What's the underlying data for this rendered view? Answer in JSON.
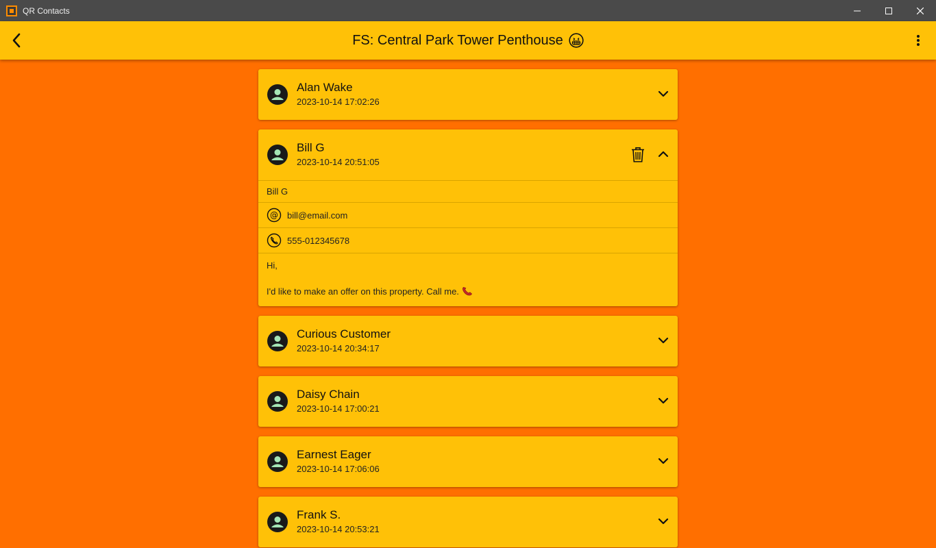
{
  "window": {
    "title": "QR Contacts"
  },
  "appbar": {
    "title": "FS: Central Park Tower Penthouse"
  },
  "contacts": [
    {
      "name": "Alan Wake",
      "date": "2023-10-14 17:02:26",
      "expanded": false
    },
    {
      "name": "Bill G",
      "date": "2023-10-14 20:51:05",
      "expanded": true,
      "details": {
        "full_name": "Bill G",
        "email": "bill@email.com",
        "phone": "555-012345678",
        "message_line1": "Hi,",
        "message_line2": "I'd like to make an offer on this property. Call me."
      }
    },
    {
      "name": "Curious Customer",
      "date": "2023-10-14 20:34:17",
      "expanded": false
    },
    {
      "name": "Daisy Chain",
      "date": "2023-10-14 17:00:21",
      "expanded": false
    },
    {
      "name": "Earnest Eager",
      "date": "2023-10-14 17:06:06",
      "expanded": false
    },
    {
      "name": "Frank S.",
      "date": "2023-10-14 20:53:21",
      "expanded": false
    }
  ],
  "icons": {
    "back": "arrow-back-icon",
    "menu": "more-vert-icon",
    "avatar": "person-icon",
    "expand": "chevron-down-icon",
    "collapse": "chevron-up-icon",
    "delete": "trash-icon",
    "email": "at-sign-icon",
    "phone": "phone-icon",
    "title_emoji": "grinning-face-icon",
    "message_emoji": "telephone-receiver-icon"
  },
  "colors": {
    "background": "#ff6f00",
    "card": "#ffc107",
    "appbar": "#ffc107",
    "titlebar": "#4a4a4a",
    "avatar_fg": "#a5e6b5"
  }
}
